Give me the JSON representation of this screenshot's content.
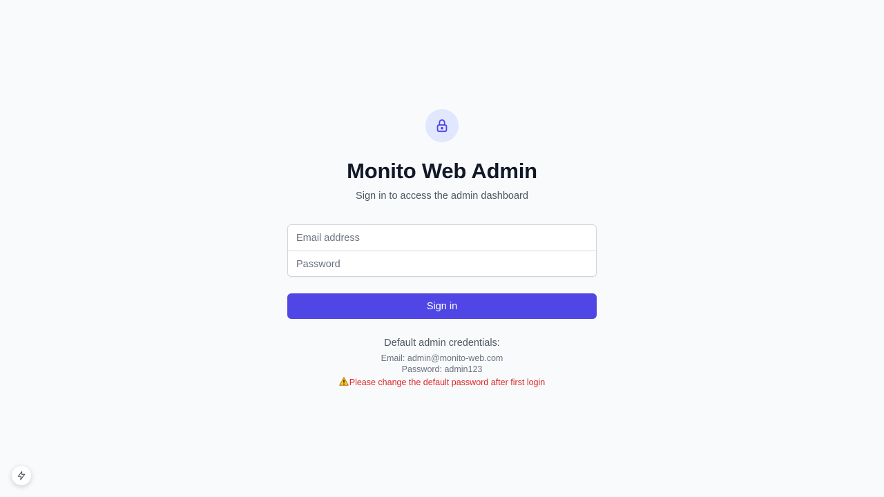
{
  "app": {
    "title": "Monito Web Admin",
    "subtitle": "Sign in to access the admin dashboard"
  },
  "form": {
    "email": {
      "value": "",
      "placeholder": "Email address"
    },
    "password": {
      "value": "",
      "placeholder": "Password"
    },
    "submit_label": "Sign in"
  },
  "credentials": {
    "heading": "Default admin credentials:",
    "email_line": "Email: admin@monito-web.com",
    "password_line": "Password: admin123",
    "warning_icon": "warning-icon",
    "warning_text": "Please change the default password after first login"
  },
  "icons": {
    "badge": "lock-icon",
    "devtools": "lightning-bolt-icon"
  },
  "colors": {
    "accent": "#4f46e5",
    "accent_light": "#e0e7ff",
    "warning": "#dc2626",
    "background": "#f9fafb"
  }
}
